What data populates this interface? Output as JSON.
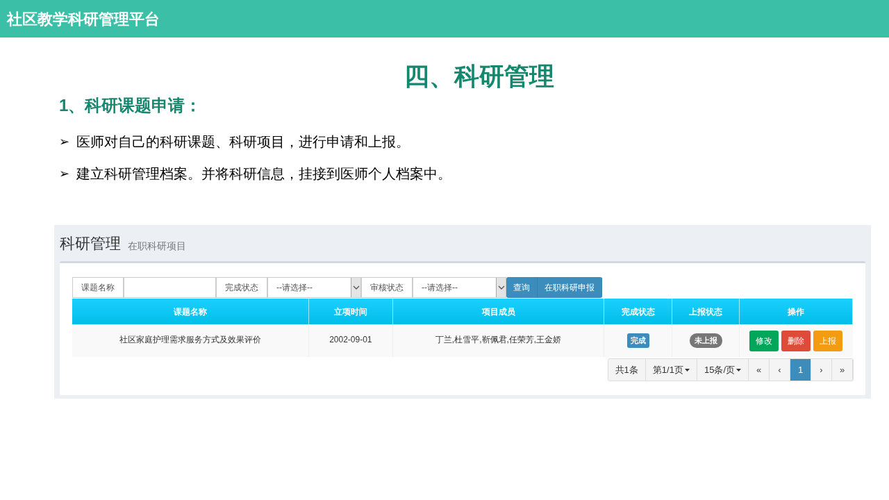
{
  "header": {
    "title": "社区教学科研管理平台"
  },
  "heading": "四、科研管理",
  "subheading": "1、科研课题申请：",
  "bullets": [
    {
      "marker": "➢",
      "text": "医师对自己的科研课题、科研项目，进行申请和上报。"
    },
    {
      "marker": "➢",
      "text": "建立科研管理档案。并将科研信息，挂接到医师个人档案中。"
    }
  ],
  "screenshot": {
    "title": "科研管理",
    "subtitle": "在职科研项目",
    "filters": [
      {
        "kind": "text",
        "label": "课题名称"
      },
      {
        "kind": "select",
        "label": "完成状态",
        "value": "--请选择--"
      },
      {
        "kind": "select",
        "label": "审核状态",
        "value": "--请选择--"
      }
    ],
    "buttons": [
      "查询",
      "在职科研申报"
    ],
    "columns": [
      "课题名称",
      "立项时间",
      "项目成员",
      "完成状态",
      "上报状态",
      "操作"
    ],
    "rows": [
      {
        "name": "社区家庭护理需求服务方式及效果评价",
        "date": "2002-09-01",
        "members": "丁兰,杜雪平,靳佩君,任荣芳,王金娇",
        "completion": {
          "text": "完成",
          "color": "#3c8dbc"
        },
        "report": {
          "text": "未上报",
          "color": "#777777"
        },
        "actions": [
          {
            "label": "修改",
            "color": "#00a65a"
          },
          {
            "label": "删除",
            "color": "#dd4b39"
          },
          {
            "label": "上报",
            "color": "#f39c12"
          }
        ]
      }
    ],
    "pagination": {
      "total": "共1条",
      "page": "第1/1页",
      "page_size": "15条/页",
      "controls": [
        {
          "label": "«",
          "selected": false
        },
        {
          "label": "‹",
          "selected": false
        },
        {
          "label": "1",
          "selected": true
        },
        {
          "label": "›",
          "selected": false
        },
        {
          "label": "»",
          "selected": false
        }
      ]
    }
  }
}
